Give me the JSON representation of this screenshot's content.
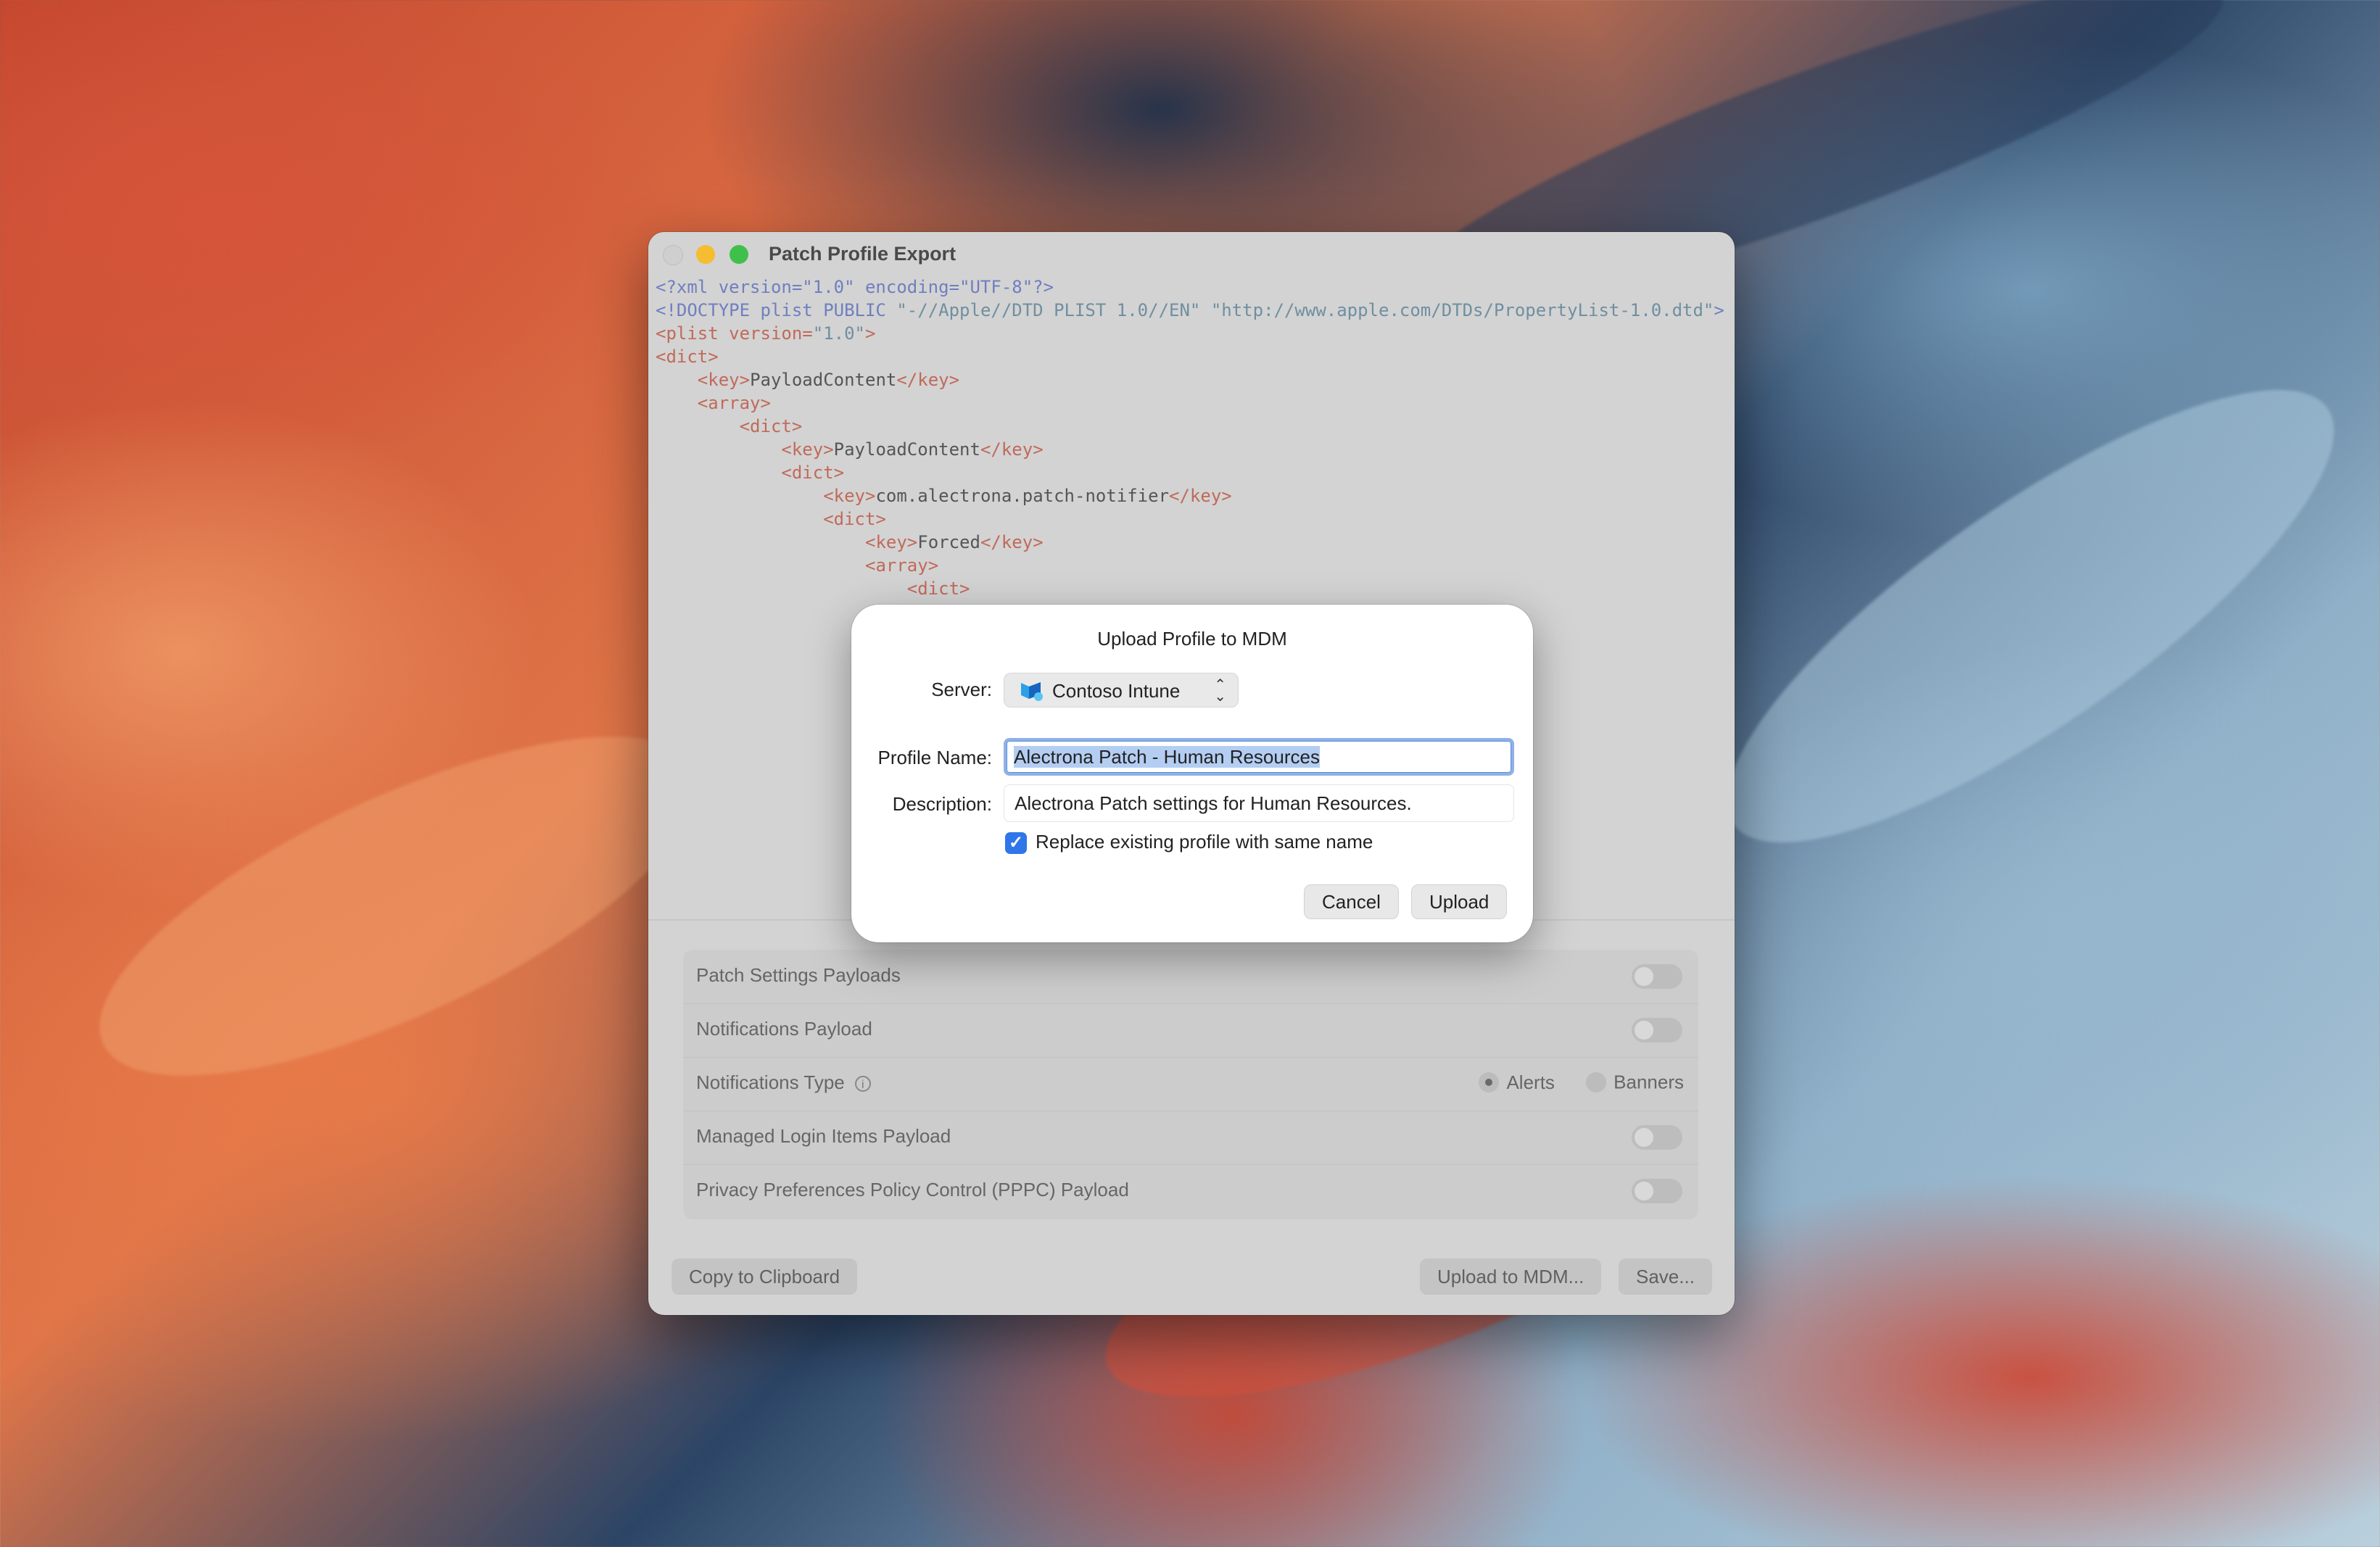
{
  "window": {
    "title": "Patch Profile Export"
  },
  "code_lines": [
    [
      {
        "t": "<?xml version=\"1.0\" encoding=\"UTF-8\"?>",
        "c": "pi"
      }
    ],
    [
      {
        "t": "<!DOCTYPE plist PUBLIC ",
        "c": "pi"
      },
      {
        "t": "\"-//Apple//DTD PLIST 1.0//EN\" \"http://www.apple.com/DTDs/PropertyList-1.0.dtd\"",
        "c": "str"
      },
      {
        "t": ">",
        "c": "pi"
      }
    ],
    [
      {
        "t": "<",
        "c": "tag"
      },
      {
        "t": "plist version=",
        "c": "tag"
      },
      {
        "t": "\"1.0\"",
        "c": "str"
      },
      {
        "t": ">",
        "c": "tag"
      }
    ],
    [
      {
        "t": "<",
        "c": "tag"
      },
      {
        "t": "dict",
        "c": "tag"
      },
      {
        "t": ">",
        "c": "tag"
      }
    ],
    [
      {
        "t": "    <",
        "c": "tag"
      },
      {
        "t": "key",
        "c": "tag"
      },
      {
        "t": ">",
        "c": "tag"
      },
      {
        "t": "PayloadContent",
        "c": "txt"
      },
      {
        "t": "</",
        "c": "tag"
      },
      {
        "t": "key",
        "c": "tag"
      },
      {
        "t": ">",
        "c": "tag"
      }
    ],
    [
      {
        "t": "    <",
        "c": "tag"
      },
      {
        "t": "array",
        "c": "tag"
      },
      {
        "t": ">",
        "c": "tag"
      }
    ],
    [
      {
        "t": "        <",
        "c": "tag"
      },
      {
        "t": "dict",
        "c": "tag"
      },
      {
        "t": ">",
        "c": "tag"
      }
    ],
    [
      {
        "t": "            <",
        "c": "tag"
      },
      {
        "t": "key",
        "c": "tag"
      },
      {
        "t": ">",
        "c": "tag"
      },
      {
        "t": "PayloadContent",
        "c": "txt"
      },
      {
        "t": "</",
        "c": "tag"
      },
      {
        "t": "key",
        "c": "tag"
      },
      {
        "t": ">",
        "c": "tag"
      }
    ],
    [
      {
        "t": "            <",
        "c": "tag"
      },
      {
        "t": "dict",
        "c": "tag"
      },
      {
        "t": ">",
        "c": "tag"
      }
    ],
    [
      {
        "t": "                <",
        "c": "tag"
      },
      {
        "t": "key",
        "c": "tag"
      },
      {
        "t": ">",
        "c": "tag"
      },
      {
        "t": "com.alectrona.patch-notifier",
        "c": "txt"
      },
      {
        "t": "</",
        "c": "tag"
      },
      {
        "t": "key",
        "c": "tag"
      },
      {
        "t": ">",
        "c": "tag"
      }
    ],
    [
      {
        "t": "                <",
        "c": "tag"
      },
      {
        "t": "dict",
        "c": "tag"
      },
      {
        "t": ">",
        "c": "tag"
      }
    ],
    [
      {
        "t": "                    <",
        "c": "tag"
      },
      {
        "t": "key",
        "c": "tag"
      },
      {
        "t": ">",
        "c": "tag"
      },
      {
        "t": "Forced",
        "c": "txt"
      },
      {
        "t": "</",
        "c": "tag"
      },
      {
        "t": "key",
        "c": "tag"
      },
      {
        "t": ">",
        "c": "tag"
      }
    ],
    [
      {
        "t": "                    <",
        "c": "tag"
      },
      {
        "t": "array",
        "c": "tag"
      },
      {
        "t": ">",
        "c": "tag"
      }
    ],
    [
      {
        "t": "                        <",
        "c": "tag"
      },
      {
        "t": "dict",
        "c": "tag"
      },
      {
        "t": ">",
        "c": "tag"
      }
    ]
  ],
  "settings": {
    "patch_settings": "Patch Settings Payloads",
    "notifications_payload": "Notifications Payload",
    "notifications_type": "Notifications Type",
    "info_glyph": "i",
    "alerts": "Alerts",
    "banners": "Banners",
    "selected_type": "Alerts",
    "managed_login": "Managed Login Items Payload",
    "pppc": "Privacy Preferences Policy Control (PPPC) Payload"
  },
  "buttons": {
    "copy": "Copy to Clipboard",
    "upload_mdm": "Upload to MDM...",
    "save": "Save..."
  },
  "modal": {
    "title": "Upload Profile to MDM",
    "server_label": "Server:",
    "server_value": "Contoso Intune",
    "profile_label": "Profile Name:",
    "profile_value": "Alectrona Patch - Human Resources",
    "description_label": "Description:",
    "description_value": "Alectrona Patch settings for Human Resources.",
    "replace_label": "Replace existing profile with same name",
    "replace_checked": true,
    "cancel": "Cancel",
    "upload": "Upload"
  },
  "colors": {
    "accent": "#2f76e8",
    "focus_ring": "#8fb1e6",
    "traffic_min": "#f5bd2f",
    "traffic_max": "#3fc04b"
  }
}
